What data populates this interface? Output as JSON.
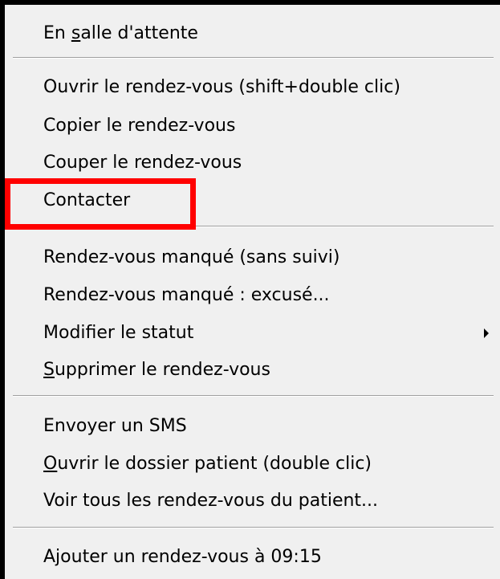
{
  "menu": {
    "items": [
      {
        "pre": "En ",
        "acc": "s",
        "post": "alle d'attente"
      },
      {
        "pre": "",
        "acc": "",
        "post": "Ouvrir le rendez-vous (shift+double clic)"
      },
      {
        "pre": "",
        "acc": "",
        "post": "Copier le rendez-vous"
      },
      {
        "pre": "",
        "acc": "",
        "post": "Couper le rendez-vous"
      },
      {
        "pre": "",
        "acc": "",
        "post": "Contacter"
      },
      {
        "pre": "",
        "acc": "",
        "post": "Rendez-vous manqué (sans suivi)"
      },
      {
        "pre": "",
        "acc": "",
        "post": "Rendez-vous manqué : excusé..."
      },
      {
        "pre": "",
        "acc": "",
        "post": "Modifier le statut"
      },
      {
        "pre": "",
        "acc": "S",
        "post": "upprimer le rendez-vous"
      },
      {
        "pre": "",
        "acc": "",
        "post": "Envoyer un SMS"
      },
      {
        "pre": "",
        "acc": "O",
        "post": "uvrir le dossier patient (double clic)"
      },
      {
        "pre": "",
        "acc": "",
        "post": "Voir tous les rendez-vous du patient..."
      },
      {
        "pre": "",
        "acc": "",
        "post": "Ajouter un rendez-vous à 09:15"
      }
    ]
  },
  "icons": {
    "submenu": "submenu-arrow-icon"
  },
  "colors": {
    "menu_background": "#f0f0f0",
    "highlight_border": "#ff0000",
    "separator": "#a0a0a0"
  }
}
